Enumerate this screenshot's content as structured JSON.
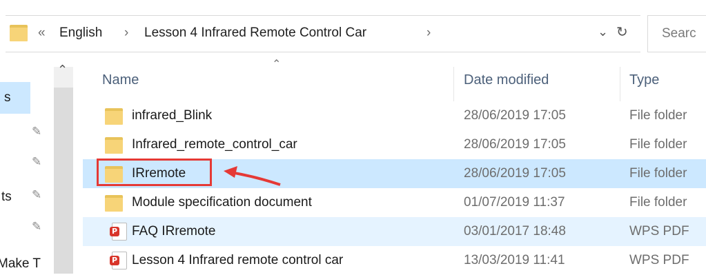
{
  "address_bar": {
    "overflow_label": "«",
    "crumbs": [
      "English",
      "Lesson 4 Infrared Remote Control Car"
    ],
    "separator": "›",
    "dropdown_icon": "chevron-down-icon",
    "refresh_icon": "refresh-icon",
    "search_placeholder": "Searc"
  },
  "nav_pane": {
    "partial_labels": [
      "s",
      "ts",
      "Make T"
    ],
    "pin_glyph": "📌"
  },
  "columns": {
    "name": "Name",
    "date_modified": "Date modified",
    "type": "Type"
  },
  "files": [
    {
      "name": "infrared_Blink",
      "date": "28/06/2019 17:05",
      "type": "File folder",
      "icon": "folder-icon"
    },
    {
      "name": "Infrared_remote_control_car",
      "date": "28/06/2019 17:05",
      "type": "File folder",
      "icon": "folder-icon"
    },
    {
      "name": "IRremote",
      "date": "28/06/2019 17:05",
      "type": "File folder",
      "icon": "folder-icon",
      "selected": true
    },
    {
      "name": "Module specification document",
      "date": "01/07/2019 11:37",
      "type": "File folder",
      "icon": "folder-icon"
    },
    {
      "name": "FAQ IRremote",
      "date": "03/01/2017 18:48",
      "type": "WPS PDF",
      "icon": "pdf-icon"
    },
    {
      "name": "Lesson 4 Infrared remote control car",
      "date": "13/03/2019 11:41",
      "type": "WPS PDF",
      "icon": "pdf-icon"
    }
  ],
  "annotation": {
    "highlight_color": "#e53935"
  },
  "colors": {
    "selection": "#cce8ff",
    "folder": "#f7d478",
    "header_text": "#4c607a"
  }
}
